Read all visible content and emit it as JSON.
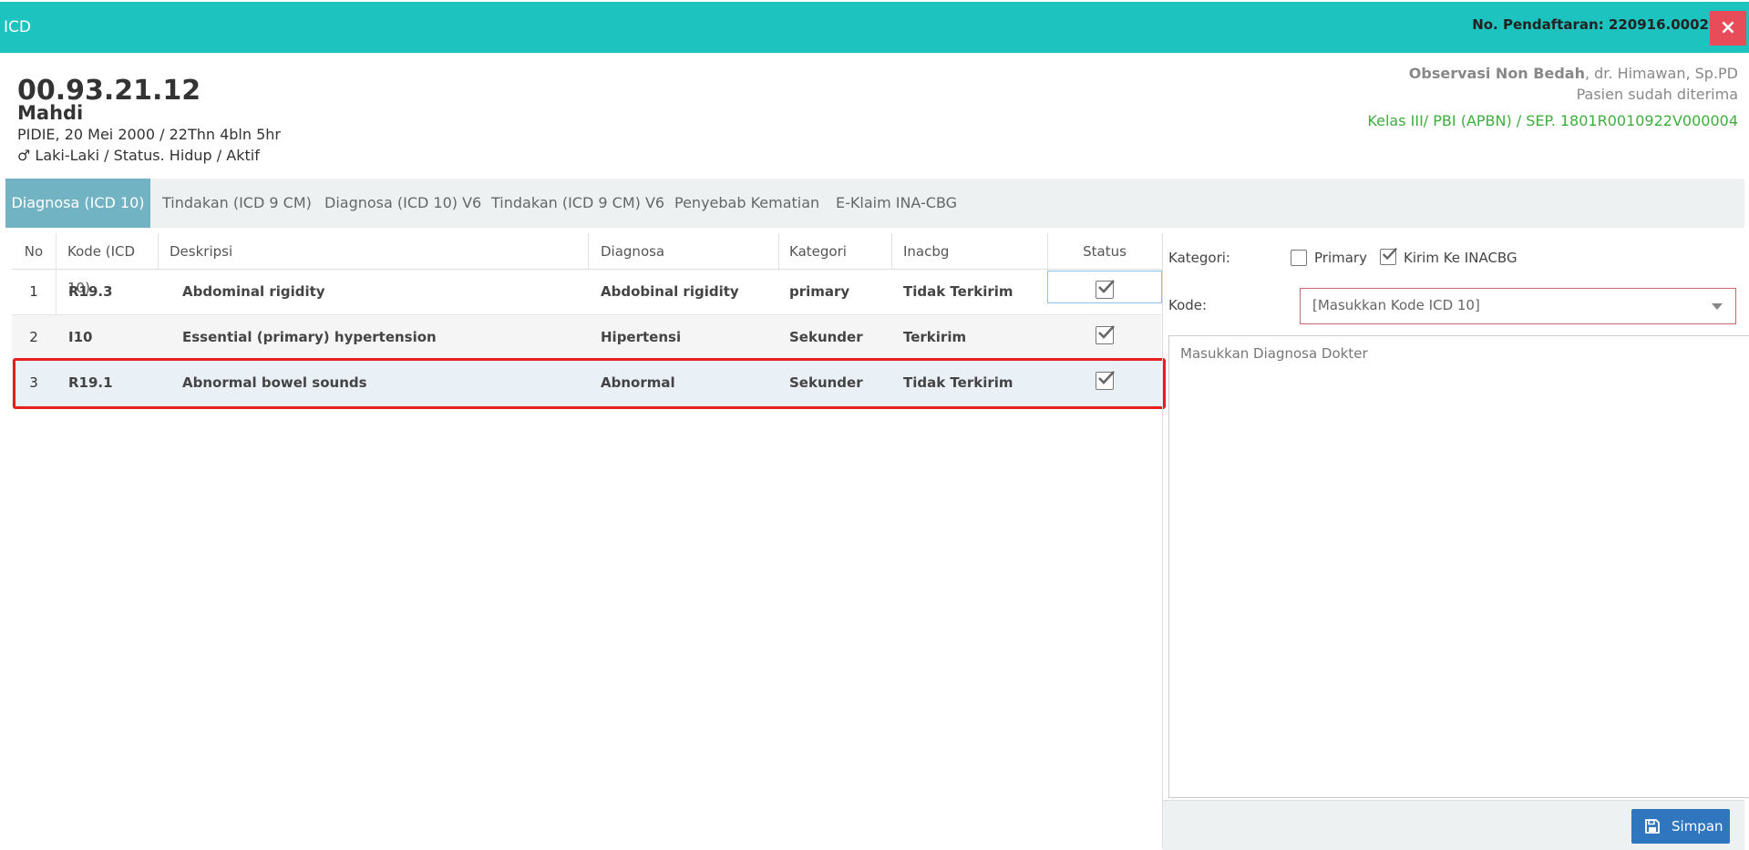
{
  "header": {
    "title": "ICD",
    "registration": "No. Pendaftaran: 220916.0002",
    "close_icon": "×"
  },
  "patient": {
    "rm_number": "00.93.21.12",
    "name": "Mahdi",
    "birth_info": "PIDIE, 20 Mei 2000 / 22Thn 4bln 5hr",
    "status_info": "♂ Laki-Laki / Status. Hidup / Aktif"
  },
  "visit": {
    "unit": "Observasi Non Bedah",
    "doctor": ", dr. Himawan, Sp.PD",
    "acceptance": "Pasien sudah diterima",
    "class_info": "Kelas III/ PBI (APBN) / SEP. 1801R0010922V000004"
  },
  "tabs": [
    {
      "label": "Diagnosa (ICD 10)"
    },
    {
      "label": "Tindakan (ICD 9 CM)"
    },
    {
      "label": "Diagnosa (ICD 10) V6"
    },
    {
      "label": "Tindakan (ICD 9 CM) V6"
    },
    {
      "label": "Penyebab Kematian"
    },
    {
      "label": "E-Klaim INA-CBG"
    }
  ],
  "table": {
    "columns": [
      "No",
      "Kode (ICD 10)",
      "Deskripsi",
      "Diagnosa",
      "Kategori",
      "Inacbg",
      "Status"
    ],
    "rows": [
      {
        "no": "1",
        "code": "R19.3",
        "description": "Abdominal rigidity",
        "diagnosa": "Abdobinal rigidity",
        "kategori": "primary",
        "inacbg": "Tidak Terkirim"
      },
      {
        "no": "2",
        "code": "I10",
        "description": "Essential (primary) hypertension",
        "diagnosa": "Hipertensi",
        "kategori": "Sekunder",
        "inacbg": "Terkirim"
      },
      {
        "no": "3",
        "code": "R19.1",
        "description": "Abnormal bowel sounds",
        "diagnosa": "Abnormal",
        "kategori": "Sekunder",
        "inacbg": "Tidak Terkirim"
      }
    ]
  },
  "form": {
    "kategori_label": "Kategori:",
    "primary_label": "Primary",
    "kirim_label": "Kirim Ke INACBG",
    "kode_label": "Kode:",
    "kode_placeholder": "[Masukkan Kode ICD 10]",
    "diagnosa_placeholder": "Masukkan Diagnosa Dokter",
    "save_label": "Simpan"
  },
  "colors": {
    "titlebar": "#1cc3bf",
    "active_tab": "#72b3c3",
    "close": "#e74c58",
    "save": "#2f76bf",
    "highlight": "#e61e1e",
    "class_text": "#3cae3c"
  }
}
